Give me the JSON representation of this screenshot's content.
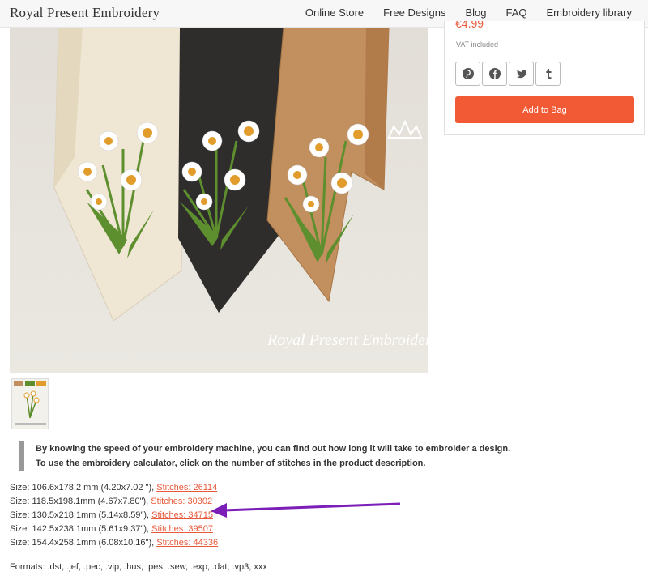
{
  "header": {
    "brand": "Royal Present Embroidery",
    "nav": [
      "Online Store",
      "Free Designs",
      "Blog",
      "FAQ",
      "Embroidery library"
    ]
  },
  "hero": {
    "watermark": "Royal Present Embroidery"
  },
  "product": {
    "price_partial": "€4.99",
    "vat": "VAT included",
    "share_icons": [
      "pinterest-icon",
      "facebook-icon",
      "twitter-icon",
      "tumblr-icon"
    ],
    "add_to_bag": "Add to Bag"
  },
  "note": {
    "line1": "By knowing the speed of your embroidery machine, you can find out how long it will take to embroider a design.",
    "line2": "To use the embroidery calculator, click on the number of stitches in the product description."
  },
  "sizes": [
    {
      "size": "Size: 106.6x178.2 mm (4.20x7.02 \"), ",
      "stitches": "Stitches: 26114"
    },
    {
      "size": "Size: 118.5x198.1mm (4.67x7.80\"), ",
      "stitches": "Stitches: 30302"
    },
    {
      "size": "Size: 130.5x218.1mm (5.14x8.59\"), ",
      "stitches": "Stitches: 34715"
    },
    {
      "size": "Size: 142.5x238.1mm (5.61x9.37\"), ",
      "stitches": "Stitches: 39507"
    },
    {
      "size": "Size: 154.4x258.1mm (6.08x10.16\"), ",
      "stitches": "Stitches: 44336"
    }
  ],
  "formats": "Formats: .dst, .jef, .pec, .vip, .hus, .pes, .sew, .exp, .dat, .vp3, xxx",
  "colors": {
    "accent": "#f25a35",
    "link": "#e8593a",
    "arrow": "#7b1fb8",
    "towel_cream": "#efe6d3",
    "towel_black": "#2e2d2c",
    "towel_tan": "#c28f5e"
  }
}
